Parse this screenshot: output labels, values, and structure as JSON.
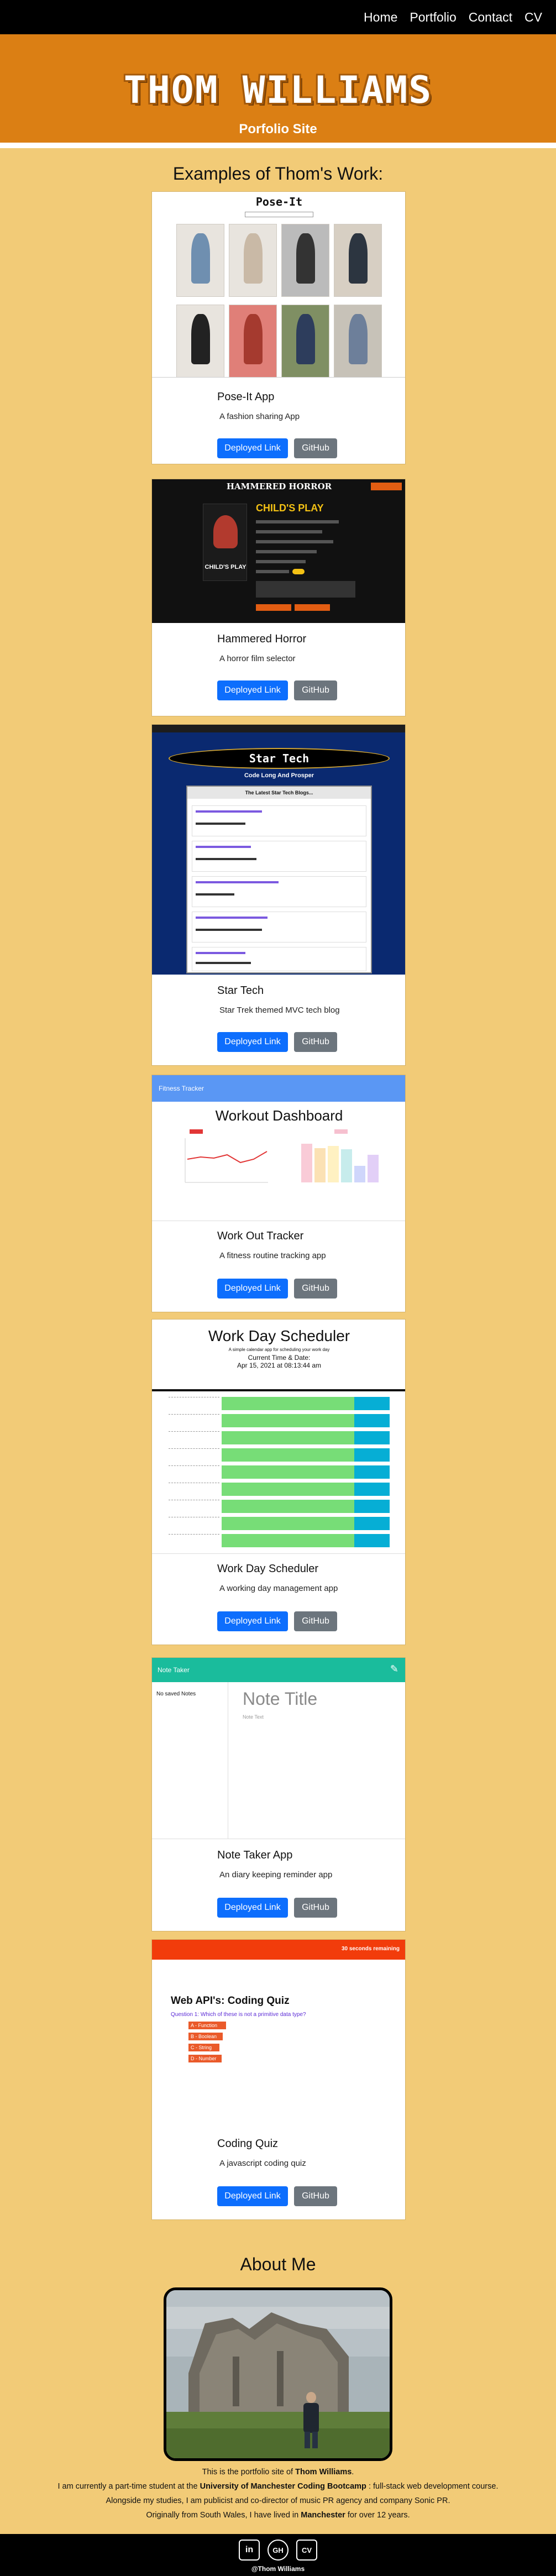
{
  "nav": {
    "home": "Home",
    "portfolio": "Portfolio",
    "contact": "Contact",
    "cv": "CV"
  },
  "header": {
    "name": "THOM WILLIAMS",
    "subtitle": "Porfolio Site"
  },
  "portfolio": {
    "title": "Examples of Thom's Work:",
    "deploy_label": "Deployed Link",
    "github_label": "GitHub",
    "projects": [
      {
        "title": "Pose-It App",
        "description": "A fashion sharing App",
        "shot_title": "Pose-It"
      },
      {
        "title": "Hammered Horror",
        "description": "A horror film selector",
        "shot_title": "HAMMERED HORROR",
        "shot_film": "CHILD'S PLAY",
        "shot_film_poster": "CHILD'S PLAY"
      },
      {
        "title": "Star Tech",
        "description": "Star Trek themed MVC tech blog",
        "shot_title": "Star Tech",
        "shot_tagline": "Code Long And Prosper",
        "shot_heading": "The Latest Star Tech Blogs..."
      },
      {
        "title": "Work Out Tracker",
        "description": "A fitness routine tracking app",
        "shot_nav": "Fitness Tracker",
        "shot_title": "Workout Dashboard"
      },
      {
        "title": "Work Day Scheduler",
        "description": "A working day management app",
        "shot_title": "Work Day Scheduler",
        "shot_sub": "A simple calendar app for scheduling your work day",
        "shot_time": "Current Time & Date:",
        "shot_date": "Apr 15, 2021 at 08:13:44 am"
      },
      {
        "title": "Note Taker App",
        "description": "An diary keeping reminder app",
        "shot_nav": "Note Taker",
        "shot_note_title": "Note Title",
        "shot_note_text": "Note Text",
        "shot_saved": "No saved Notes"
      },
      {
        "title": "Coding Quiz",
        "description": "A javascript coding quiz",
        "shot_timer": "30 seconds remaining",
        "shot_title": "Web API's: Coding Quiz",
        "shot_question": "Question 1: Which of these is not a primitive data type?",
        "shot_answers": [
          "A - Function",
          "B - Boolean",
          "C - String",
          "D - Number"
        ]
      }
    ]
  },
  "about": {
    "title": "About Me",
    "line1_a": "This is the portfolio site of ",
    "line1_b": "Thom Williams",
    "line1_c": ".",
    "line2_a": "I am currently a part-time student at the ",
    "line2_b": "University of Manchester Coding Bootcamp",
    "line2_c": " : full-stack web development course.",
    "line3": "Alongside my studies, I am publicist and co-director of music PR agency and company Sonic PR.",
    "line4_a": "Originally from South Wales, I have lived in ",
    "line4_b": "Manchester",
    "line4_c": " for over 12 years."
  },
  "footer": {
    "linkedin": "in",
    "github": "GH",
    "cv": "CV",
    "copyright": "@Thom Williams"
  },
  "colors": {
    "page_bg": "#f2cb77",
    "hero": "#db7f14",
    "primary": "#0d6efd",
    "secondary": "#6c757d"
  }
}
